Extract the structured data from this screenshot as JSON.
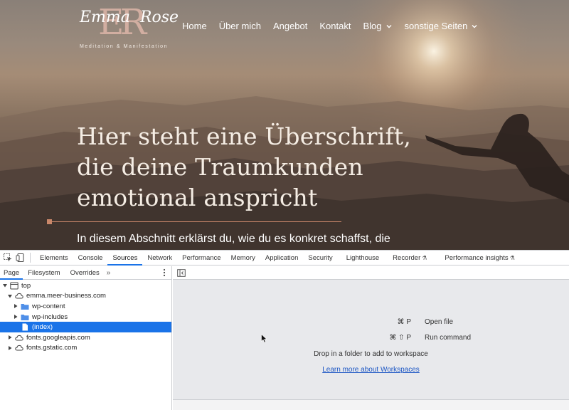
{
  "site": {
    "logo": {
      "monogram": "ER",
      "script_first": "Emma",
      "script_last": "Rose",
      "tagline": "Meditation & Manifestation"
    },
    "nav": [
      {
        "label": "Home",
        "dropdown": false
      },
      {
        "label": "Über mich",
        "dropdown": false
      },
      {
        "label": "Angebot",
        "dropdown": false
      },
      {
        "label": "Kontakt",
        "dropdown": false
      },
      {
        "label": "Blog",
        "dropdown": true
      },
      {
        "label": "sonstige Seiten",
        "dropdown": true
      }
    ],
    "headline": [
      "Hier steht eine Überschrift,",
      "die deine Traumkunden",
      "emotional anspricht"
    ],
    "subtext": "In diesem Abschnitt erklärst du, wie du es konkret schaffst, die",
    "accent_color": "#c9876a"
  },
  "devtools": {
    "tabs": [
      {
        "label": "Elements",
        "active": false
      },
      {
        "label": "Console",
        "active": false
      },
      {
        "label": "Sources",
        "active": true
      },
      {
        "label": "Network",
        "active": false
      },
      {
        "label": "Performance",
        "active": false
      },
      {
        "label": "Memory",
        "active": false
      },
      {
        "label": "Application",
        "active": false
      },
      {
        "label": "Security",
        "active": false
      },
      {
        "label": "Lighthouse",
        "active": false
      },
      {
        "label": "Recorder",
        "active": false,
        "experimental": true
      },
      {
        "label": "Performance insights",
        "active": false,
        "experimental": true
      }
    ],
    "sources": {
      "sub_tabs": [
        {
          "label": "Page",
          "active": true
        },
        {
          "label": "Filesystem",
          "active": false
        },
        {
          "label": "Overrides",
          "active": false
        }
      ],
      "more_tabs": "»",
      "tree": [
        {
          "label": "top",
          "indent": 0,
          "expanded": true,
          "icon": "frame-icon",
          "selected": false
        },
        {
          "label": "emma.meer-business.com",
          "indent": 1,
          "expanded": true,
          "icon": "cloud-icon",
          "selected": false
        },
        {
          "label": "wp-content",
          "indent": 2,
          "expanded": false,
          "icon": "folder-icon",
          "selected": false
        },
        {
          "label": "wp-includes",
          "indent": 2,
          "expanded": false,
          "icon": "folder-icon",
          "selected": false
        },
        {
          "label": "(index)",
          "indent": 2,
          "expanded": null,
          "icon": "file-icon",
          "selected": true
        },
        {
          "label": "fonts.googleapis.com",
          "indent": 0,
          "expanded": false,
          "icon": "cloud-icon",
          "selected": false
        },
        {
          "label": "fonts.gstatic.com",
          "indent": 0,
          "expanded": false,
          "icon": "cloud-icon",
          "selected": false
        }
      ],
      "editor": {
        "shortcuts": [
          {
            "keys": "⌘ P",
            "label": "Open file"
          },
          {
            "keys": "⌘ ⇧ P",
            "label": "Run command"
          }
        ],
        "drop_hint": "Drop in a folder to add to workspace",
        "learn_link": "Learn more about Workspaces"
      }
    },
    "selection_color": "#1a73e8"
  }
}
